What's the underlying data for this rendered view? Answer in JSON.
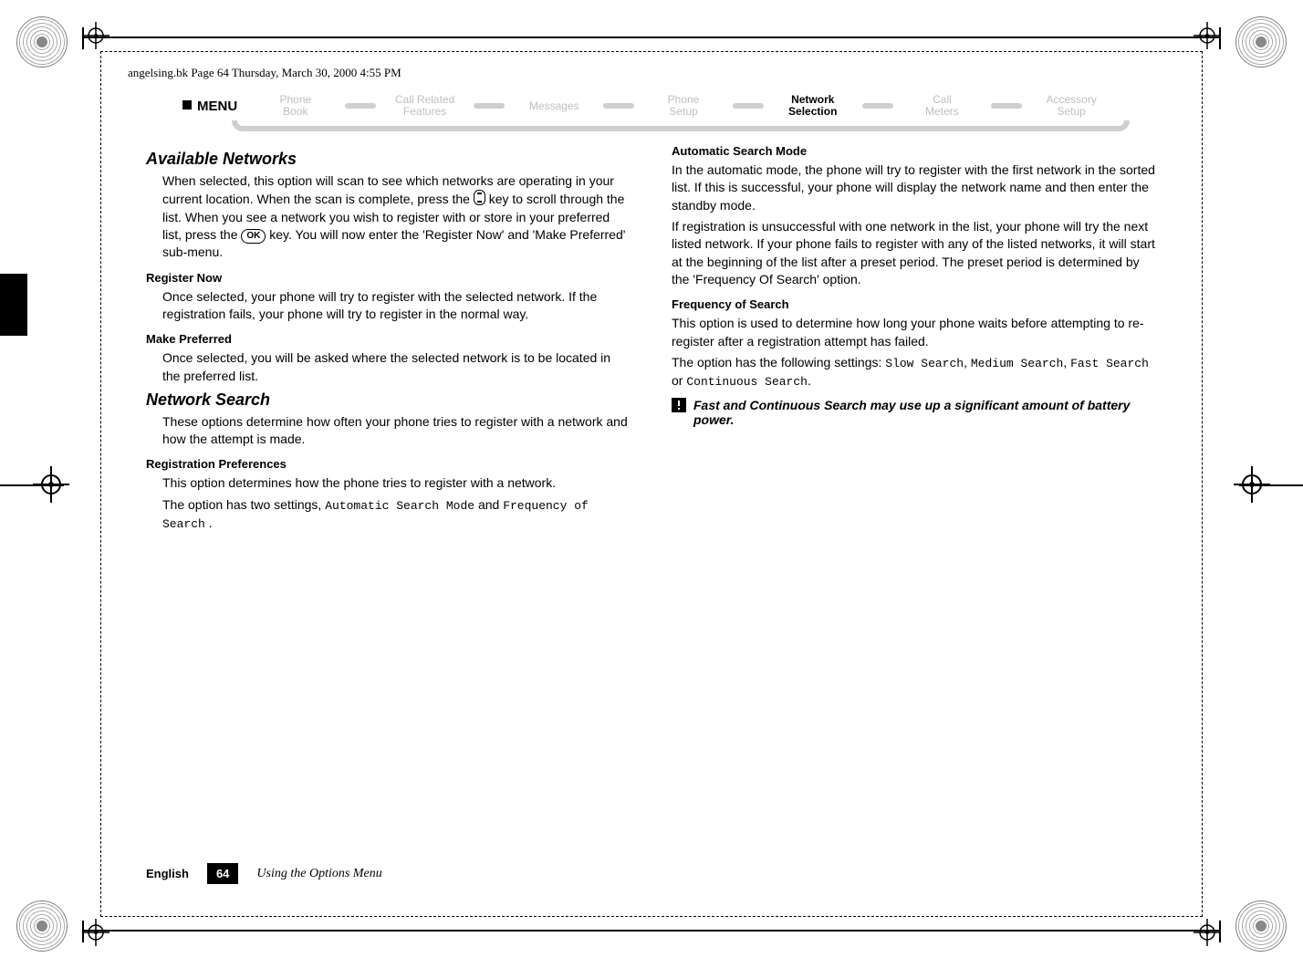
{
  "running_head": "angelsing.bk  Page 64  Thursday, March 30, 2000  4:55 PM",
  "menu_label": "MENU",
  "tabs": [
    {
      "l1": "Phone",
      "l2": "Book",
      "active": false
    },
    {
      "l1": "Call Related",
      "l2": "Features",
      "active": false
    },
    {
      "l1": "Messages",
      "l2": "",
      "active": false
    },
    {
      "l1": "Phone",
      "l2": "Setup",
      "active": false
    },
    {
      "l1": "Network",
      "l2": "Selection",
      "active": true
    },
    {
      "l1": "Call",
      "l2": "Meters",
      "active": false
    },
    {
      "l1": "Accessory",
      "l2": "Setup",
      "active": false
    }
  ],
  "col_left": {
    "h2_available": "Available Networks",
    "p_available_1a": "When selected, this option will scan to see which networks are operating in your current location. When the scan is complete, press the ",
    "p_available_1b": " key to scroll through the list. When you see a network you wish to register with or store in your preferred list, press the ",
    "p_available_1c": " key. You will now enter the 'Register Now' and 'Make Preferred' sub-menu.",
    "ok_label": "OK",
    "h3_registernow": "Register Now",
    "p_registernow": "Once selected, your phone will try to register with the selected network. If the registration fails, your phone will try to register in the normal way.",
    "h3_makepref": "Make Preferred",
    "p_makepref": "Once selected, you will be asked where the selected network is to be located in the preferred list.",
    "h2_search": "Network Search",
    "p_search": "These options determine how often your phone tries to register with a network and how the attempt is made.",
    "h3_regpref": "Registration Preferences",
    "p_regpref_intro": "This option determines how the phone tries to register with a network.",
    "p_regpref_two_a": "The option has two settings, ",
    "mono_auto": "Automatic Search Mode",
    "p_regpref_two_b": " and ",
    "mono_freq": "Frequency of Search",
    "p_regpref_two_c": "."
  },
  "col_right": {
    "h3_auto": "Automatic Search Mode",
    "p_auto1": "In the automatic mode, the phone will try to register with the first network in the sorted list. If this is successful, your phone will display the network name and then enter the standby mode.",
    "p_auto2": "If registration is unsuccessful with one network in the list, your phone will try the next listed network. If your phone fails to register with any of the listed networks, it will start at the beginning of the list after a preset period. The preset period is determined by the 'Frequency Of Search' option.",
    "h3_freq": "Frequency of Search",
    "p_freq1": "This option is used to determine how long your phone waits before attempting to re-register after a registration attempt has failed.",
    "p_freq2_a": "The option has the following settings: ",
    "mono_slow": "Slow Search",
    "sep_comma": ", ",
    "mono_med": "Medium Search",
    "mono_fast": "Fast Search",
    "sep_or": " or ",
    "mono_cont": "Continuous Search",
    "period": ".",
    "note_text": "Fast and Continuous Search may use up a significant amount of battery power."
  },
  "footer": {
    "lang": "English",
    "page": "64",
    "section": "Using the Options Menu"
  }
}
